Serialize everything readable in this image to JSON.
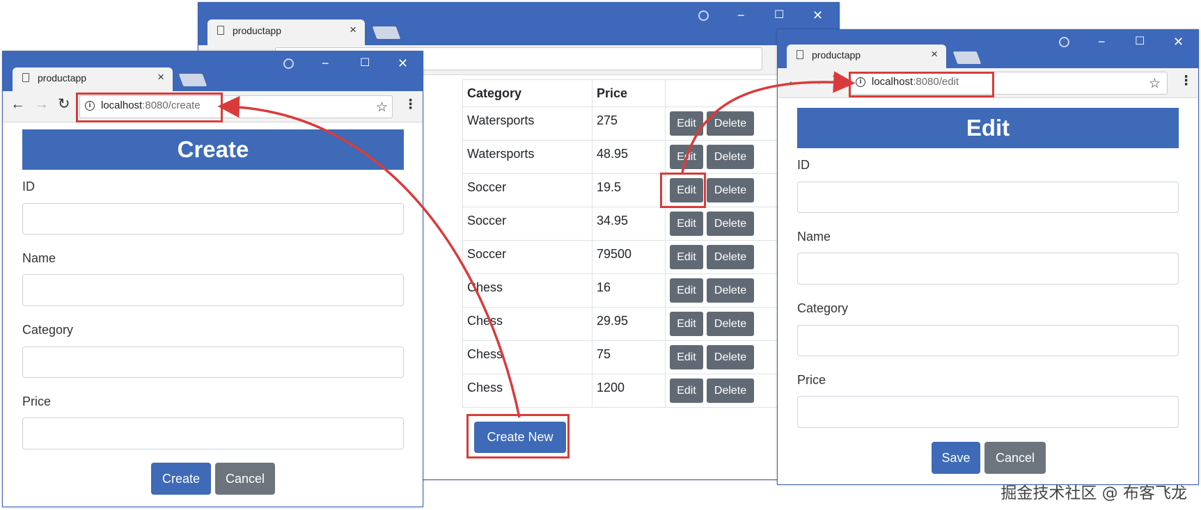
{
  "list_window": {
    "tab_title": "productapp",
    "close_tab": "×",
    "table": {
      "headers": [
        "Category",
        "Price"
      ],
      "rows": [
        {
          "category": "Watersports",
          "price": "275",
          "edit": "Edit",
          "delete": "Delete"
        },
        {
          "category": "Watersports",
          "price": "48.95",
          "edit": "Edit",
          "delete": "Delete"
        },
        {
          "category": "Soccer",
          "price": "19.5",
          "edit": "Edit",
          "delete": "Delete"
        },
        {
          "category": "Soccer",
          "price": "34.95",
          "edit": "Edit",
          "delete": "Delete"
        },
        {
          "category": "Soccer",
          "price": "79500",
          "edit": "Edit",
          "delete": "Delete"
        },
        {
          "category": "Chess",
          "price": "16",
          "edit": "Edit",
          "delete": "Delete"
        },
        {
          "category": "Chess",
          "price": "29.95",
          "edit": "Edit",
          "delete": "Delete"
        },
        {
          "category": "Chess",
          "price": "75",
          "edit": "Edit",
          "delete": "Delete"
        },
        {
          "category": "Chess",
          "price": "1200",
          "edit": "Edit",
          "delete": "Delete"
        }
      ]
    },
    "create_new_label": "Create New"
  },
  "create_window": {
    "tab_title": "productapp",
    "close_tab": "×",
    "url_host": "localhost",
    "url_path": ":8080/create",
    "header": "Create",
    "fields": {
      "id": "ID",
      "name": "Name",
      "category": "Category",
      "price": "Price"
    },
    "submit_label": "Create",
    "cancel_label": "Cancel"
  },
  "edit_window": {
    "tab_title": "productapp",
    "close_tab": "×",
    "url_host": "localhost",
    "url_path": ":8080/edit",
    "header": "Edit",
    "fields": {
      "id": "ID",
      "name": "Name",
      "category": "Category",
      "price": "Price"
    },
    "submit_label": "Save",
    "cancel_label": "Cancel"
  },
  "icons": {
    "back": "←",
    "forward": "→",
    "reload": "↻",
    "star": "☆",
    "menu": "⋮",
    "minimize": "−",
    "maximize": "☐",
    "close": "✕",
    "info": "i"
  },
  "watermark": "掘金技术社区 @ 布客飞龙",
  "colors": {
    "accent": "#3e6ab7",
    "secondary": "#6c757d",
    "highlight": "#d93b3b",
    "titlebar": "#3e68b9"
  }
}
